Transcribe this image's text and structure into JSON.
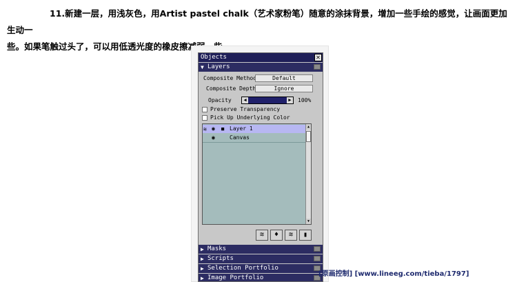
{
  "instruction": {
    "line1": "11.新建一层，用浅灰色，用Artist pastel chalk（艺术家粉笔）随意的涂抹背景，增加一些手绘的感觉，让画面更加生动一",
    "line2": "些。如果笔触过头了，可以用低透光度的橡皮擦减弱一些。"
  },
  "objects_panel": {
    "title": "Objects",
    "close_glyph": "✕",
    "layers": {
      "header": "Layers",
      "composite_method_label": "Composite Method",
      "composite_method_value": "Default",
      "composite_depth_label": "Composite Depth",
      "composite_depth_value": "Ignore",
      "opacity_label": "Opacity",
      "opacity_value": "100%",
      "preserve_transparency": "Preserve Transparency",
      "pick_up_underlying_color": "Pick Up Underlying Color",
      "items": [
        {
          "name": "Layer 1",
          "selected": true,
          "locked": true
        },
        {
          "name": "Canvas",
          "selected": false,
          "locked": false
        }
      ]
    },
    "sections": [
      "Masks",
      "Scripts",
      "Selection Portfolio",
      "Image Portfolio"
    ]
  },
  "watermark": "[原画控制]  [www.lineeg.com/tieba/1797]",
  "icons": {
    "close": "close-icon",
    "eye": "eye-icon",
    "lock": "lock-icon",
    "trash": "trash-icon"
  },
  "colors": {
    "title_bar": "#1f1f58",
    "layer_list_bg": "#a4bcbc",
    "selected_layer": "#b7b7f2",
    "panel_bg": "#c8c8c8"
  }
}
